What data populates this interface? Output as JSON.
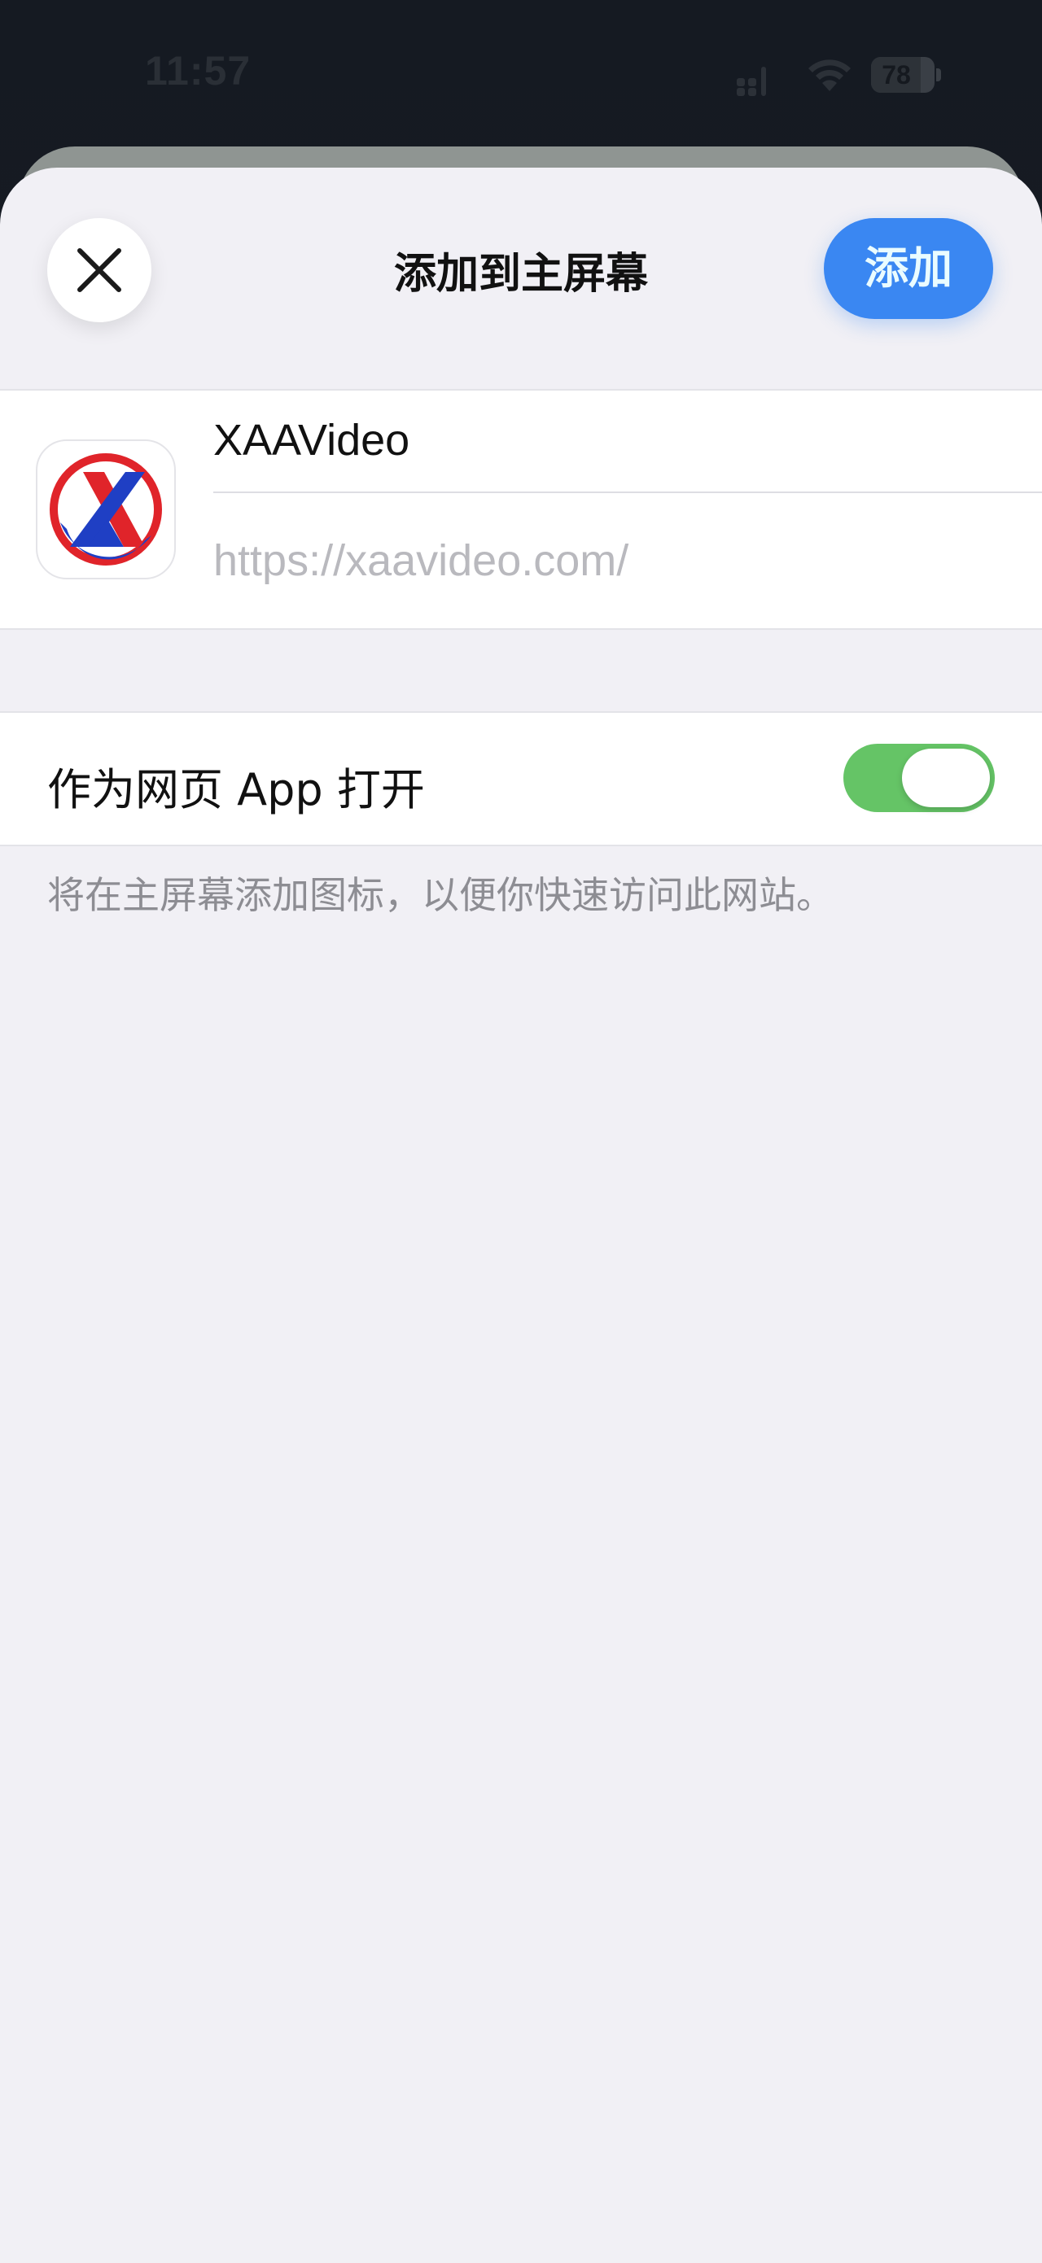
{
  "status_bar": {
    "time": "11:57",
    "battery_level": "78",
    "battery_fraction": 0.78,
    "icons": [
      "signal-icon",
      "wifi-icon",
      "battery-icon"
    ]
  },
  "sheet": {
    "title": "添加到主屏幕",
    "close_icon": "close-icon",
    "add_label": "添加"
  },
  "app": {
    "name": "XAAVideo",
    "url": "https://xaavideo.com/",
    "icon": "app-logo-icon"
  },
  "web_app_toggle": {
    "label": "作为网页 App 打开",
    "on": true
  },
  "footer": {
    "note": "将在主屏幕添加图标，以便你快速访问此网站。"
  },
  "colors": {
    "accent": "#3a87f2",
    "toggle_on": "#65c466",
    "sheet_bg": "#f1f0f5",
    "logo_red": "#e0242a",
    "logo_blue": "#1f3fc4"
  }
}
